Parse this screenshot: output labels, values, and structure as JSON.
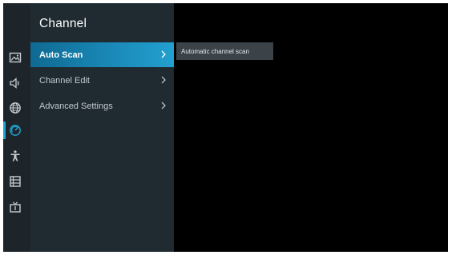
{
  "menu": {
    "title": "Channel",
    "items": [
      {
        "label": "Auto Scan",
        "active": true,
        "icon": "chevron-right-icon"
      },
      {
        "label": "Channel Edit",
        "active": false,
        "icon": "chevron-right-icon"
      },
      {
        "label": "Advanced Settings",
        "active": false,
        "icon": "chevron-right-icon"
      }
    ]
  },
  "tooltip": {
    "text": "Automatic channel scan"
  },
  "sidebar": {
    "icons": [
      {
        "name": "picture-icon",
        "active": false
      },
      {
        "name": "sound-icon",
        "active": false
      },
      {
        "name": "network-icon",
        "active": false
      },
      {
        "name": "channel-icon",
        "active": true
      },
      {
        "name": "accessibility-icon",
        "active": false
      },
      {
        "name": "system-icon",
        "active": false
      },
      {
        "name": "support-icon",
        "active": false
      }
    ]
  },
  "colors": {
    "accent": "#1b8bba",
    "rail_bg": "#1d252b",
    "panel_bg": "#1f2a31",
    "screen_bg": "#000000"
  }
}
